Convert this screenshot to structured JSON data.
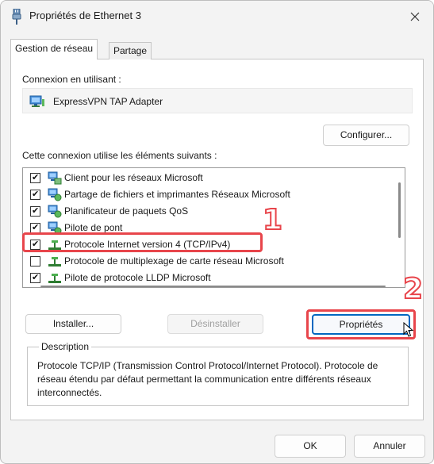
{
  "window": {
    "title": "Propriétés de Ethernet 3"
  },
  "tabs": [
    {
      "label": "Gestion de réseau",
      "active": true
    },
    {
      "label": "Partage",
      "active": false
    }
  ],
  "connection": {
    "label": "Connexion en utilisant :",
    "adapter_name": "ExpressVPN TAP Adapter",
    "configure_button": "Configurer..."
  },
  "items_section": {
    "label": "Cette connexion utilise les éléments suivants :",
    "items": [
      {
        "label": "Client pour les réseaux Microsoft",
        "checked": true,
        "icon": "network-client-icon"
      },
      {
        "label": "Partage de fichiers et imprimantes Réseaux Microsoft",
        "checked": true,
        "icon": "network-service-icon"
      },
      {
        "label": "Planificateur de paquets QoS",
        "checked": true,
        "icon": "network-service-icon"
      },
      {
        "label": "Pilote de pont",
        "checked": true,
        "icon": "network-service-icon"
      },
      {
        "label": "Protocole Internet version 4 (TCP/IPv4)",
        "checked": true,
        "icon": "protocol-icon"
      },
      {
        "label": "Protocole de multiplexage de carte réseau Microsoft",
        "checked": false,
        "icon": "protocol-icon"
      },
      {
        "label": "Pilote de protocole LLDP Microsoft",
        "checked": true,
        "icon": "protocol-icon"
      }
    ]
  },
  "actions": {
    "install": "Installer...",
    "uninstall": "Désinstaller",
    "properties": "Propriétés"
  },
  "description": {
    "legend": "Description",
    "text": "Protocole TCP/IP (Transmission Control Protocol/Internet Protocol). Protocole de réseau étendu par défaut permettant la communication entre différents réseaux interconnectés."
  },
  "footer": {
    "ok": "OK",
    "cancel": "Annuler"
  },
  "annotations": {
    "step1": "1",
    "step2": "2",
    "highlight_color": "#e8454b"
  },
  "colors": {
    "accent": "#0067c0",
    "checkbox_check": "#111111"
  }
}
